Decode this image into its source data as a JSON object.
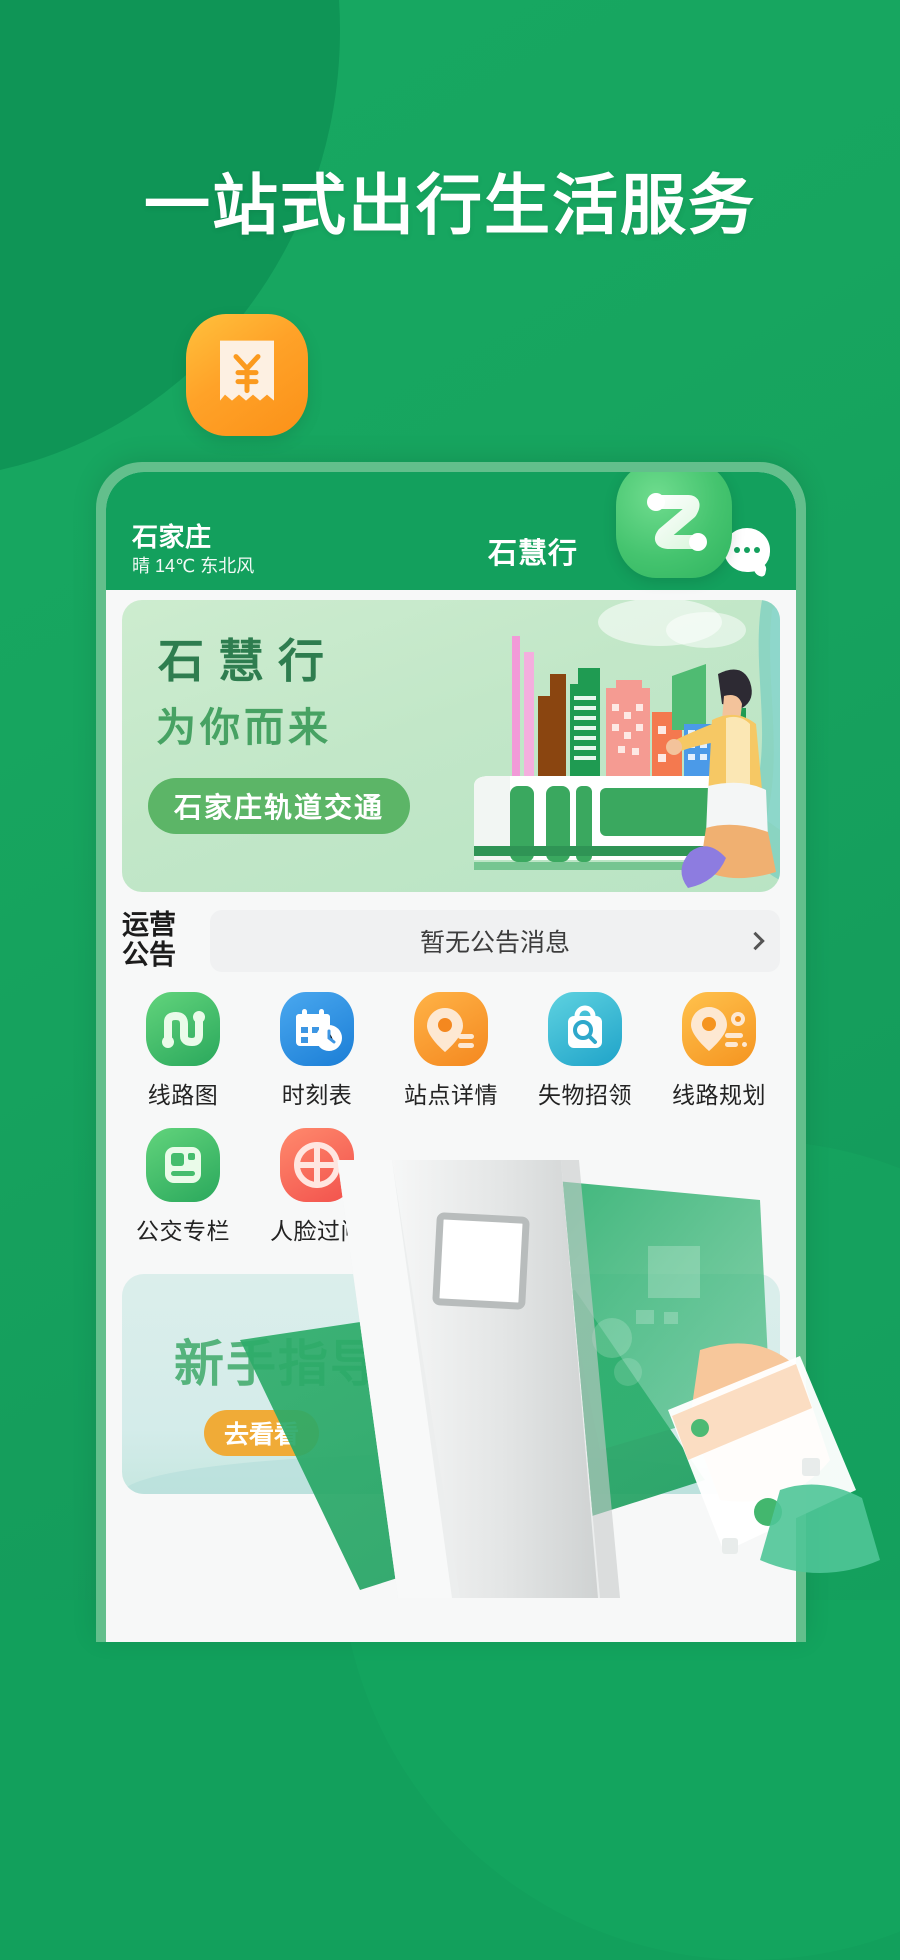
{
  "theme": {
    "brand_green": "#13a05d",
    "page_green": "#17a55f",
    "accent_orange": "#f6a128",
    "banner_green": "#5cb567",
    "card_mint": "#dbeeeb"
  },
  "headline": "一站式出行生活服务",
  "app_icon": {
    "name": "receipt-yen-icon",
    "symbol": "¥"
  },
  "brand_badge": {
    "name": "route-logo-badge"
  },
  "phone": {
    "header": {
      "city": "石家庄",
      "weather": "晴 14℃ 东北风",
      "title": "石慧行",
      "chat_button": "chat-dots-icon"
    },
    "banner": {
      "title": "石慧行",
      "subtitle": "为你而来",
      "pill_label": "石家庄轨道交通"
    },
    "notice": {
      "label": "运营公告",
      "label_line1": "运营",
      "label_line2": "公告",
      "text": "暂无公告消息",
      "chevron": "chevron-right-icon"
    },
    "grid": [
      {
        "label": "线路图",
        "icon": "route-map-icon",
        "color": "#3ebd6a"
      },
      {
        "label": "时刻表",
        "icon": "timetable-icon",
        "color": "#2a8fe0"
      },
      {
        "label": "站点详情",
        "icon": "station-pin-icon",
        "color": "#f79a2a"
      },
      {
        "label": "失物招领",
        "icon": "lost-found-bag-icon",
        "color": "#2fb4d1"
      },
      {
        "label": "线路规划",
        "icon": "route-plan-icon",
        "color": "#f8a42a"
      },
      {
        "label": "公交专栏",
        "icon": "bus-column-icon",
        "color": "#3fbe6d"
      },
      {
        "label": "人脸过闸",
        "icon": "face-gate-icon",
        "color": "#f4604f"
      }
    ],
    "guide_card": {
      "title": "新手指导",
      "button_label": "去看看"
    }
  },
  "overlay_art": {
    "gate": "subway-gate-illustration",
    "card": "green-transit-card",
    "hand_phone": "hand-holding-phone-qr"
  }
}
